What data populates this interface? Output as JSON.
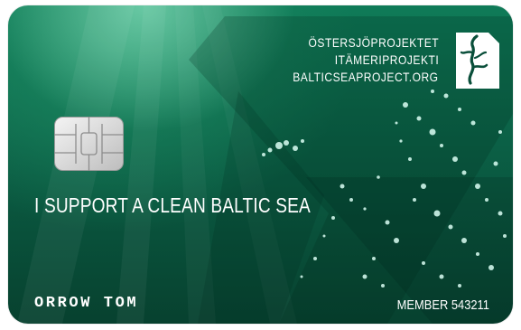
{
  "card": {
    "org_names": [
      "ÖSTERSJÖPROJEKTET",
      "ITÄMERIPROJEKTI",
      "BALTICSEAPROJECT.ORG"
    ],
    "slogan": "I SUPPORT A CLEAN BALTIC SEA",
    "holder_name": "ORROW TOM",
    "member_label": "MEMBER 543211"
  },
  "colors": {
    "card_dark": "#07412f",
    "card_mid": "#0b5f45",
    "card_light": "#1c8a62",
    "text": "#ffffff"
  },
  "icons": [
    "chip-icon",
    "seaweed-logo-icon",
    "bubbles"
  ]
}
